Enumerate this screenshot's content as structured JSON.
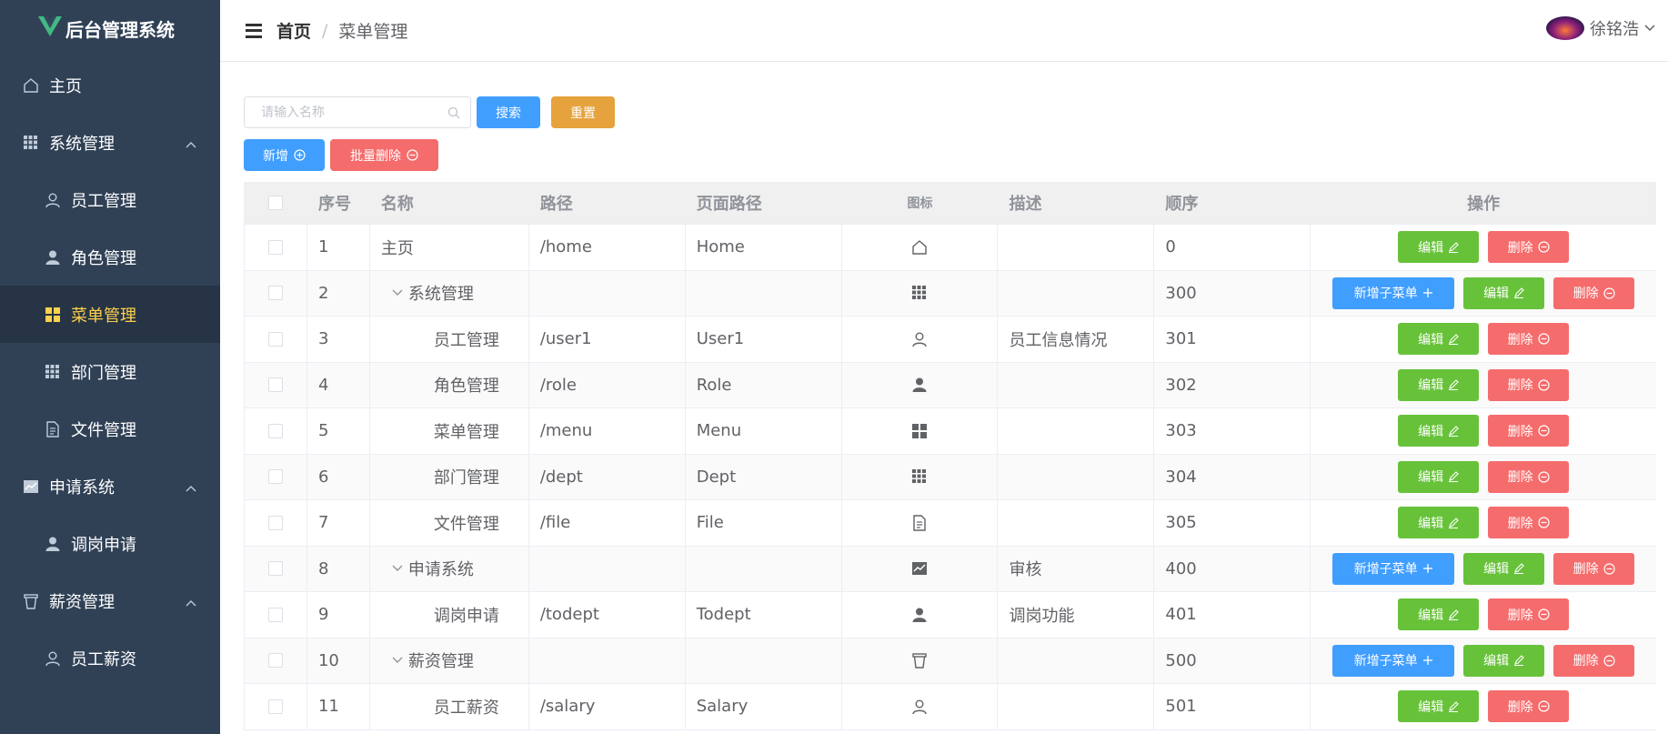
{
  "app": {
    "title": "后台管理系统"
  },
  "sidebar": {
    "items": [
      {
        "label": "主页",
        "icon": "home-icon",
        "level": "top"
      },
      {
        "label": "系统管理",
        "icon": "grid-icon",
        "level": "top",
        "expandable": true
      },
      {
        "label": "员工管理",
        "icon": "user-icon",
        "level": "sub"
      },
      {
        "label": "角色管理",
        "icon": "user-solid-icon",
        "level": "sub"
      },
      {
        "label": "菜单管理",
        "icon": "menu-icon",
        "level": "sub",
        "active": true
      },
      {
        "label": "部门管理",
        "icon": "grid-icon",
        "level": "sub"
      },
      {
        "label": "文件管理",
        "icon": "document-icon",
        "level": "sub"
      },
      {
        "label": "申请系统",
        "icon": "chart-icon",
        "level": "top",
        "expandable": true
      },
      {
        "label": "调岗申请",
        "icon": "user-solid-icon",
        "level": "sub"
      },
      {
        "label": "薪资管理",
        "icon": "bin-icon",
        "level": "top",
        "expandable": true
      },
      {
        "label": "员工薪资",
        "icon": "user-icon",
        "level": "sub"
      }
    ]
  },
  "header": {
    "breadcrumb": {
      "home": "首页",
      "separator": "/",
      "current": "菜单管理"
    },
    "user": {
      "name": "徐铭浩"
    }
  },
  "toolbar": {
    "search_placeholder": "请输入名称",
    "search_label": "搜索",
    "reset_label": "重置",
    "add_label": "新增",
    "batch_delete_label": "批量删除"
  },
  "table": {
    "columns": [
      "序号",
      "名称",
      "路径",
      "页面路径",
      "图标",
      "描述",
      "顺序",
      "操作"
    ],
    "rows": [
      {
        "idx": "1",
        "name": "主页",
        "path": "/home",
        "page": "Home",
        "icon": "home-icon",
        "desc": "",
        "order": "0",
        "level": 1,
        "parent": false
      },
      {
        "idx": "2",
        "name": "系统管理",
        "path": "",
        "page": "",
        "icon": "grid-icon",
        "desc": "",
        "order": "300",
        "level": 1,
        "parent": true
      },
      {
        "idx": "3",
        "name": "员工管理",
        "path": "/user1",
        "page": "User1",
        "icon": "user-icon",
        "desc": "员工信息情况",
        "order": "301",
        "level": 2,
        "parent": false
      },
      {
        "idx": "4",
        "name": "角色管理",
        "path": "/role",
        "page": "Role",
        "icon": "user-solid-icon",
        "desc": "",
        "order": "302",
        "level": 2,
        "parent": false
      },
      {
        "idx": "5",
        "name": "菜单管理",
        "path": "/menu",
        "page": "Menu",
        "icon": "menu-icon",
        "desc": "",
        "order": "303",
        "level": 2,
        "parent": false
      },
      {
        "idx": "6",
        "name": "部门管理",
        "path": "/dept",
        "page": "Dept",
        "icon": "grid-icon",
        "desc": "",
        "order": "304",
        "level": 2,
        "parent": false
      },
      {
        "idx": "7",
        "name": "文件管理",
        "path": "/file",
        "page": "File",
        "icon": "document-icon",
        "desc": "",
        "order": "305",
        "level": 2,
        "parent": false
      },
      {
        "idx": "8",
        "name": "申请系统",
        "path": "",
        "page": "",
        "icon": "chart-icon",
        "desc": "审核",
        "order": "400",
        "level": 1,
        "parent": true
      },
      {
        "idx": "9",
        "name": "调岗申请",
        "path": "/todept",
        "page": "Todept",
        "icon": "user-solid-icon",
        "desc": "调岗功能",
        "order": "401",
        "level": 2,
        "parent": false
      },
      {
        "idx": "10",
        "name": "薪资管理",
        "path": "",
        "page": "",
        "icon": "bin-icon",
        "desc": "",
        "order": "500",
        "level": 1,
        "parent": true
      },
      {
        "idx": "11",
        "name": "员工薪资",
        "path": "/salary",
        "page": "Salary",
        "icon": "user-icon",
        "desc": "",
        "order": "501",
        "level": 2,
        "parent": false
      }
    ],
    "actions": {
      "add_child": "新增子菜单",
      "edit": "编辑",
      "delete": "删除"
    }
  },
  "colors": {
    "sidebar_bg": "#304156",
    "active_text": "#ffd04b",
    "primary": "#409eff",
    "success": "#67c23a",
    "warning": "#e6a23c",
    "danger": "#f56c6c"
  }
}
